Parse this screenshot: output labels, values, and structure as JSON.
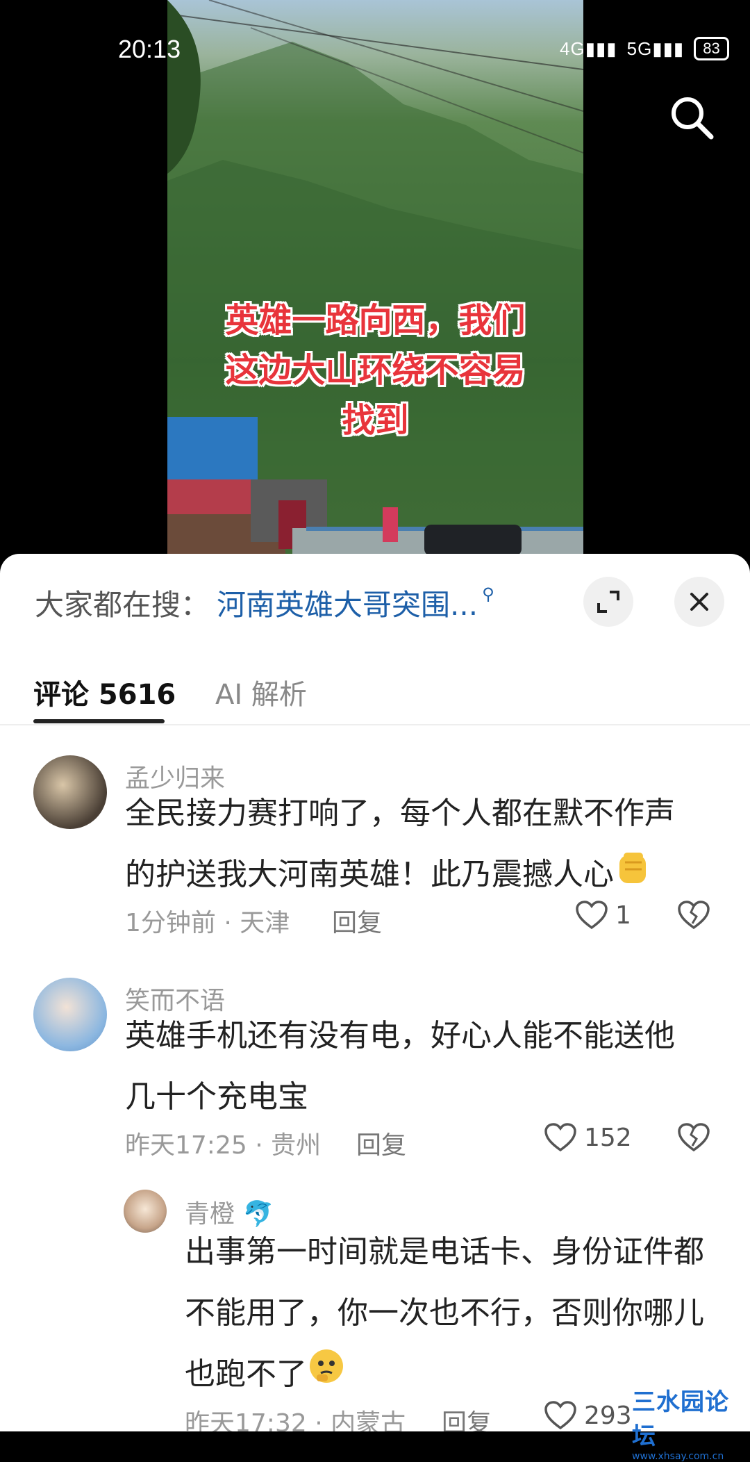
{
  "status_bar": {
    "time": "20:13",
    "signal_1": "4G",
    "signal_2": "5G",
    "battery": "83"
  },
  "video": {
    "caption_lines": [
      "英雄一路向西，我们",
      "这边大山环绕不容易",
      "找到"
    ]
  },
  "search_bar": {
    "label": "大家都在搜：",
    "query": "河南英雄大哥突围..."
  },
  "tabs": [
    {
      "label": "评论 5616",
      "active": true
    },
    {
      "label": "AI 解析",
      "active": false
    }
  ],
  "comments": [
    {
      "username": "孟少归来",
      "text_lines": [
        "全民接力赛打响了，每个人都在默不作声",
        "的护送我大河南英雄！此乃震撼人心"
      ],
      "meta": "1分钟前 · 天津",
      "reply_label": "回复",
      "likes": "1"
    },
    {
      "username": "笑而不语",
      "text_lines": [
        "英雄手机还有没有电，好心人能不能送他",
        "几十个充电宝"
      ],
      "meta": "昨天17:25 · 贵州",
      "reply_label": "回复",
      "likes": "152"
    },
    {
      "username": "青橙",
      "text_lines": [
        "出事第一时间就是电话卡、身份证件都",
        "不能用了，你一次也不行，否则你哪儿",
        "也跑不了"
      ],
      "meta": "昨天17:32 · 内蒙古",
      "reply_label": "回复",
      "likes": "293"
    }
  ],
  "watermark": {
    "title": "三水园论坛",
    "url": "www.xhsay.com.cn"
  }
}
